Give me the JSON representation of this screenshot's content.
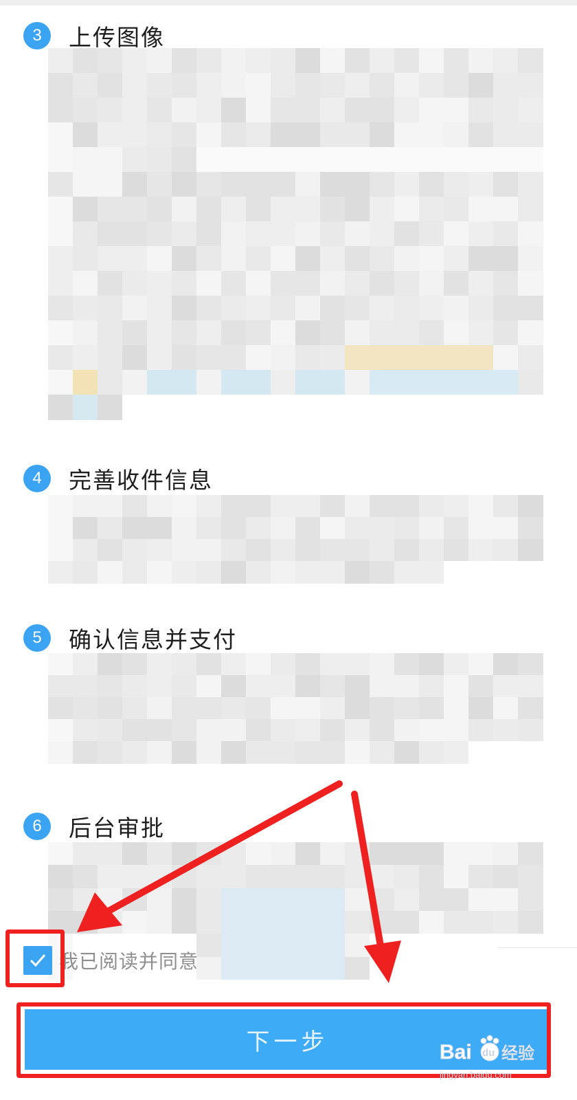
{
  "steps": [
    {
      "number": "3",
      "title": "上传图像"
    },
    {
      "number": "4",
      "title": "完善收件信息"
    },
    {
      "number": "5",
      "title": "确认信息并支付"
    },
    {
      "number": "6",
      "title": "后台审批"
    }
  ],
  "agreement": {
    "checked": true,
    "label": "我已阅读并同意"
  },
  "next_button": {
    "label": "下一步"
  },
  "watermark": {
    "brand": "Bai",
    "brand2": "du",
    "cn": "经验",
    "url": "jingyan.baidu.com"
  },
  "colors": {
    "accent": "#3aa3f2",
    "button": "#3eabf6",
    "annotation": "#ee2020"
  },
  "icons": {
    "checkbox": "check-icon",
    "annotation": "arrow-icon"
  }
}
